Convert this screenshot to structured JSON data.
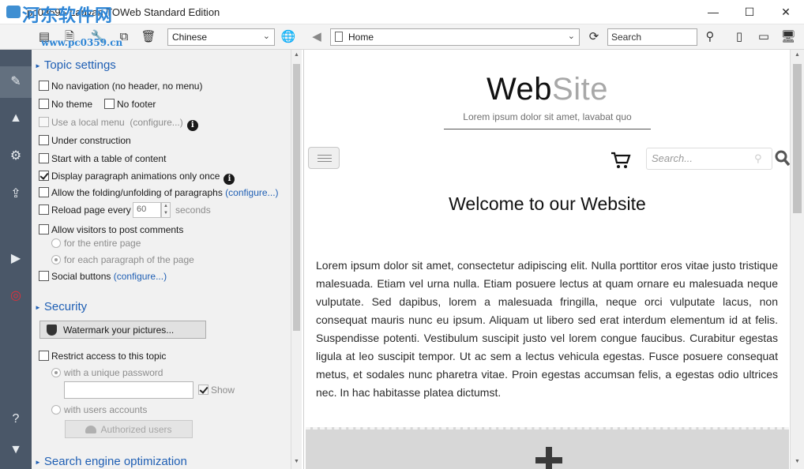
{
  "window": {
    "title": "pc0359 - Lauyan TOWeb Standard Edition",
    "watermark": "河东软件网",
    "watermark_url": "www.pc0359.cn"
  },
  "toolbar": {
    "language": "Chinese",
    "url": "Home",
    "search_placeholder": "Search"
  },
  "panel": {
    "topic_settings": {
      "header": "Topic settings",
      "no_navigation": "No navigation (no header, no menu)",
      "no_theme": "No theme",
      "no_footer": "No footer",
      "local_menu": "Use a local menu",
      "local_menu_link": "(configure...)",
      "under_construction": "Under construction",
      "table_of_content": "Start with a table of content",
      "paragraph_animations": "Display paragraph animations only once",
      "folding": "Allow the folding/unfolding of paragraphs",
      "folding_link": "(configure...)",
      "reload": "Reload page every",
      "reload_value": "60",
      "reload_unit": "seconds",
      "comments": "Allow visitors to post comments",
      "comments_entire": "for the entire page",
      "comments_paragraph": "for each paragraph of the page",
      "social": "Social buttons",
      "social_link": "(configure...)"
    },
    "security": {
      "header": "Security",
      "watermark_button": "Watermark your pictures...",
      "restrict": "Restrict access to this topic",
      "unique_password": "with a unique password",
      "show": "Show",
      "users_accounts": "with users accounts",
      "authorized_users": "Authorized users"
    },
    "seo": {
      "header": "Search engine optimization"
    }
  },
  "preview": {
    "site_title_a": "Web",
    "site_title_b": "Site",
    "site_subtitle": "Lorem ipsum dolor sit amet, lavabat quo",
    "search_placeholder": "Search...",
    "welcome": "Welcome to our Website",
    "body": "Lorem ipsum dolor sit amet, consectetur adipiscing elit. Nulla porttitor eros vitae justo tristique malesuada. Etiam vel urna nulla. Etiam posuere lectus at quam ornare eu malesuada neque vulputate. Sed dapibus, lorem a malesuada fringilla, neque orci vulputate lacus, non consequat mauris nunc eu ipsum. Aliquam ut libero sed erat interdum elementum id at felis. Suspendisse potenti. Vestibulum suscipit justo vel lorem congue faucibus. Curabitur egestas ligula at leo suscipit tempor. Ut ac sem a lectus vehicula egestas. Fusce posuere consequat metus, et sodales nunc pharetra vitae. Proin egestas accumsan felis, a egestas odio ultrices nec. In hac habitasse platea dictumst."
  },
  "colors": {
    "accent": "#1f5fb4",
    "rail": "#4a5768",
    "watermark": "#2f86d6"
  }
}
